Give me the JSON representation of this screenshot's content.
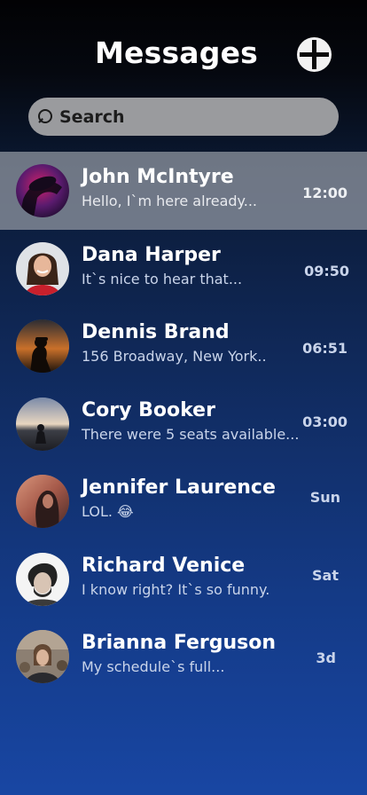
{
  "header": {
    "title": "Messages",
    "compose_icon": "plus-circle-icon"
  },
  "search": {
    "placeholder": "Search",
    "value": "",
    "icon": "search-icon"
  },
  "conversations": [
    {
      "name": "John McIntyre",
      "preview": "Hello, I`m here already...",
      "time": "12:00",
      "selected": true
    },
    {
      "name": "Dana Harper",
      "preview": "It`s nice to hear that...",
      "time": "09:50",
      "selected": false
    },
    {
      "name": "Dennis Brand",
      "preview": "156 Broadway, New York..",
      "time": "06:51",
      "selected": false
    },
    {
      "name": "Cory Booker",
      "preview": "There were 5 seats available...",
      "time": "03:00",
      "selected": false
    },
    {
      "name": "Jennifer Laurence",
      "preview": "LOL. 😂",
      "time": "Sun",
      "selected": false
    },
    {
      "name": "Richard Venice",
      "preview": "I know right? It`s so funny.",
      "time": "Sat",
      "selected": false
    },
    {
      "name": "Brianna Ferguson",
      "preview": "My schedule`s full...",
      "time": "3d",
      "selected": false
    }
  ],
  "colors": {
    "background_top": "#020204",
    "background_bottom": "#1846a3",
    "selected_row": "#969ba5",
    "search_field": "#9a9b9e",
    "secondary_text": "#c9d4ea"
  }
}
